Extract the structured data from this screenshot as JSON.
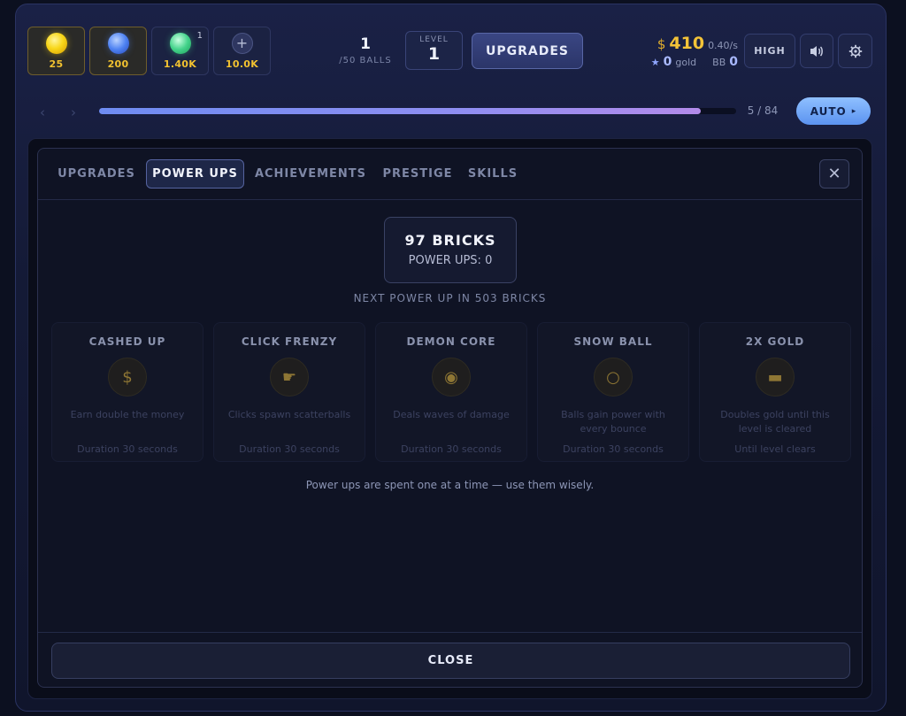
{
  "shop": {
    "balls": [
      {
        "price": "25",
        "color": "#f8d71a",
        "owned": true,
        "badge": ""
      },
      {
        "price": "200",
        "color": "#4e82f2",
        "owned": true,
        "badge": ""
      },
      {
        "price": "1.40K",
        "color": "#44d38b",
        "owned": false,
        "badge": "1"
      },
      {
        "price": "10.0K",
        "color": "#2e3660",
        "owned": false,
        "badge": "",
        "plus": "+"
      }
    ]
  },
  "stats": {
    "balls_value": "1",
    "balls_max": "/50 BALLS",
    "level_label": "LEVEL",
    "level_value": "1",
    "upgrades_label": "UPGRADES",
    "money_currency": "$",
    "money_value": "410",
    "money_rate": "0.40/s",
    "gold_star": "★",
    "gold_value": "0",
    "gold_label": "gold",
    "bb_label": "BB",
    "bb_value": "0"
  },
  "controls": {
    "quality_label": "HIGH",
    "sound_icon": "speaker-icon",
    "settings_icon": "gear-icon"
  },
  "progress": {
    "prev": "‹",
    "next": "›",
    "current": 5,
    "total": 84,
    "fraction": 0.944,
    "text": "5 / 84",
    "auto_label": "AUTO",
    "auto_arrow": "▸"
  },
  "modal": {
    "tabs": [
      {
        "label": "UPGRADES",
        "active": false
      },
      {
        "label": "POWER UPS",
        "active": true
      },
      {
        "label": "ACHIEVEMENTS",
        "active": false
      },
      {
        "label": "PRESTIGE",
        "active": false
      },
      {
        "label": "SKILLS",
        "active": false
      }
    ],
    "close_x": "✕",
    "bricks_title": "97 BRICKS",
    "powerups_count": "POWER UPS: 0",
    "next_powerup": "NEXT POWER UP IN 503 BRICKS",
    "cards": [
      {
        "name": "CASHED UP",
        "icon": "$",
        "desc": "Earn double the money",
        "duration": "Duration 30 seconds"
      },
      {
        "name": "CLICK FRENZY",
        "icon": "☛",
        "desc": "Clicks spawn scatterballs",
        "duration": "Duration 30 seconds"
      },
      {
        "name": "DEMON CORE",
        "icon": "◉",
        "desc": "Deals waves of damage",
        "duration": "Duration 30 seconds"
      },
      {
        "name": "SNOW BALL",
        "icon": "○",
        "desc": "Balls gain power with every bounce",
        "duration": "Duration 30 seconds"
      },
      {
        "name": "2X GOLD",
        "icon": "▬",
        "desc": "Doubles gold until this level is cleared",
        "duration": "Until level clears"
      }
    ],
    "hint": "Power ups are spent one at a time — use them wisely.",
    "close_label": "CLOSE"
  },
  "colors": {
    "accent": "#6e8cf2",
    "gold": "#f3c338",
    "background": "#0c1020"
  }
}
